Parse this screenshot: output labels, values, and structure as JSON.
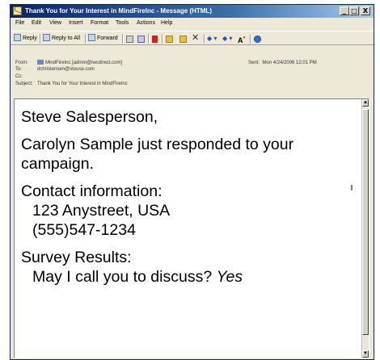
{
  "window": {
    "title": "Thank You for Your Interest in MindFireInc - Message (HTML)",
    "controls": {
      "minimize": "_",
      "maximize": "□",
      "close": "X"
    }
  },
  "menu": [
    "File",
    "Edit",
    "View",
    "Insert",
    "Format",
    "Tools",
    "Actions",
    "Help"
  ],
  "toolbar": {
    "reply": "Reply",
    "reply_all": "Reply to All",
    "forward": "Forward",
    "extra_icons": [
      "print-icon",
      "save-icon",
      "flag-icon",
      "folder-icon",
      "move-icon",
      "delete-icon",
      "previous-icon",
      "next-icon",
      "font-size-icon",
      "help-icon"
    ]
  },
  "header": {
    "from_label": "From:",
    "from_value": "MindFireInc [admin@lwcdirect.com]",
    "to_label": "To:",
    "to_value": "dchristensen@stouse.com",
    "cc_label": "Cc:",
    "subject_label": "Subject:",
    "subject_value": "Thank You for Your Interest in MindFireInc",
    "sent_label": "Sent:",
    "sent_value": "Mon 4/24/2006 12:01 PM"
  },
  "message": {
    "greeting": "Steve Salesperson,",
    "line1": "Carolyn Sample just responded to your campaign.",
    "contact_heading": "Contact information:",
    "address": "123 Anystreet, USA",
    "phone": "(555)547-1234",
    "survey_heading": "Survey Results:",
    "survey_question": "May I call you to discuss?",
    "survey_answer": "Yes"
  }
}
